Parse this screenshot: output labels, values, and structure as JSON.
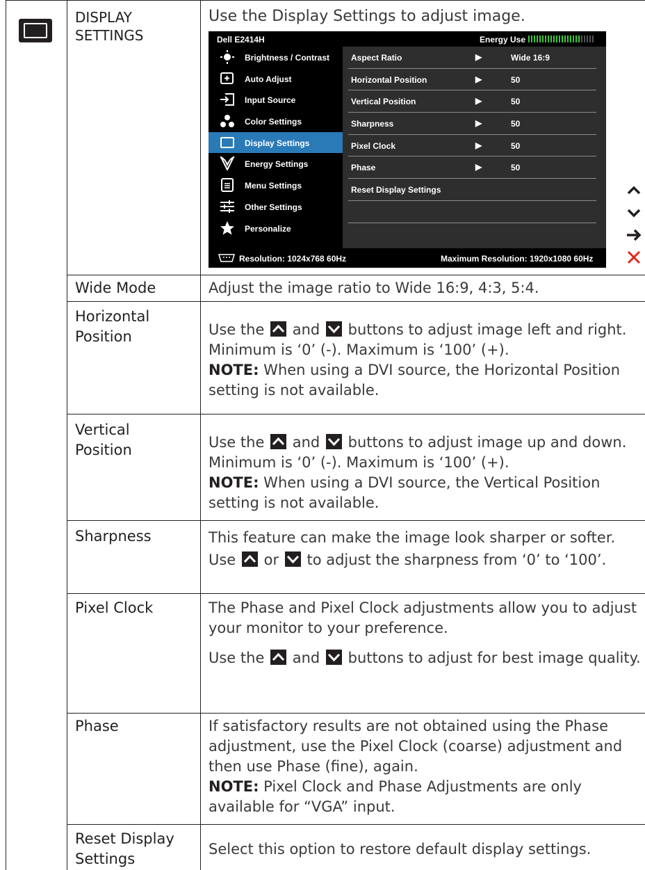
{
  "header": {
    "section_label": "DISPLAY\nSETTINGS",
    "intro": "Use the Display Settings to adjust image."
  },
  "osd": {
    "model": "Dell E2414H",
    "energy_label": "Energy Use",
    "menu": [
      {
        "label": "Brightness / Contrast",
        "icon": "brightness-icon"
      },
      {
        "label": "Auto Adjust",
        "icon": "auto-adjust-icon"
      },
      {
        "label": "Input Source",
        "icon": "input-source-icon"
      },
      {
        "label": "Color Settings",
        "icon": "color-settings-icon"
      },
      {
        "label": "Display Settings",
        "icon": "display-settings-icon"
      },
      {
        "label": "Energy Settings",
        "icon": "energy-settings-icon"
      },
      {
        "label": "Menu Settings",
        "icon": "menu-settings-icon"
      },
      {
        "label": "Other Settings",
        "icon": "other-settings-icon"
      },
      {
        "label": "Personalize",
        "icon": "star-icon"
      }
    ],
    "selected_index": 4,
    "submenu": [
      {
        "label": "Aspect Ratio",
        "value": "Wide 16:9"
      },
      {
        "label": "Horizontal Position",
        "value": "50"
      },
      {
        "label": "Vertical Position",
        "value": "50"
      },
      {
        "label": "Sharpness",
        "value": "50"
      },
      {
        "label": "Pixel Clock",
        "value": "50"
      },
      {
        "label": "Phase",
        "value": "50"
      },
      {
        "label": "Reset Display Settings",
        "value": ""
      }
    ],
    "resolution": "Resolution:  1024x768 60Hz",
    "max_resolution": "Maximum Resolution: 1920x1080 60Hz",
    "colors": {
      "selected": "#2a7ab8",
      "energy": "#3cc83c",
      "close": "#e0261b"
    }
  },
  "side_buttons": [
    "up-arrow-icon",
    "down-arrow-icon",
    "right-arrow-icon",
    "close-icon"
  ],
  "rows": [
    {
      "label": "Wide Mode",
      "desc": "Adjust the image ratio to Wide 16:9, 4:3, 5:4."
    },
    {
      "label": "Horizontal\nPosition",
      "p1": "Use the",
      "p2": "and",
      "p3": "buttons to adjust image left and right. Minimum is ‘0’ (-). Maximum is ‘100’ (+).",
      "note": "NOTE:",
      "note_text": " When using a DVI source, the Horizontal Position setting is not available."
    },
    {
      "label": "Vertical\nPosition",
      "p1": "Use the",
      "p2": "and",
      "p3": "buttons to adjust image up and down. Minimum is ‘0’ (-). Maximum is ‘100’ (+).",
      "note": "NOTE:",
      "note_text": " When using a DVI source, the Vertical Position setting is not available."
    },
    {
      "label": "Sharpness",
      "p0": "This feature can make the image look sharper or softer. Use",
      "p2": "or",
      "p3": "to adjust the sharpness from ‘0’ to ‘100’."
    },
    {
      "label": "Pixel Clock",
      "d1": "The Phase and Pixel Clock adjustments allow you to adjust your monitor to your preference.",
      "p1": "Use the",
      "p2": "and",
      "p3": "buttons to adjust for best image quality."
    },
    {
      "label": "Phase",
      "desc": "If satisfactory results are not obtained using the Phase adjustment, use the Pixel Clock (coarse) adjustment and then use Phase (fine), again.",
      "note": "NOTE:",
      "note_text": " Pixel Clock and Phase Adjustments are only available for “VGA” input."
    },
    {
      "label": "Reset Display\nSettings",
      "desc": "Select this option to restore default display settings."
    }
  ]
}
